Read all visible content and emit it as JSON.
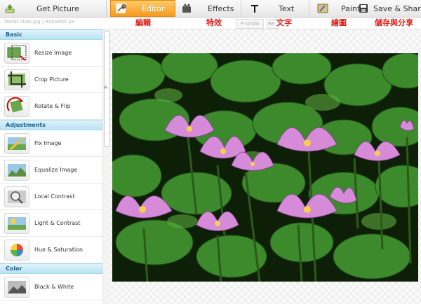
{
  "tabs": [
    {
      "label": "Get Picture",
      "icon": "upload-icon"
    },
    {
      "label": "Editor",
      "icon": "wrench-icon",
      "active": true
    },
    {
      "label": "Effects",
      "icon": "effects-icon"
    },
    {
      "label": "Text",
      "icon": "text-icon"
    },
    {
      "label": "Paint",
      "icon": "paint-icon"
    },
    {
      "label": "Save & Share",
      "icon": "save-icon"
    }
  ],
  "file_info": "Water lilies.jpg | 800x600 px",
  "chinese_labels": {
    "editor": "編輯",
    "effects": "特效",
    "text": "文字",
    "paint": "繪圖",
    "save_share": "儲存與分享"
  },
  "history": {
    "undo": "Undo",
    "redo": "Re"
  },
  "sections": [
    {
      "title": "Basic",
      "tools": [
        {
          "label": "Resize Image",
          "icon": "resize-icon"
        },
        {
          "label": "Crop Picture",
          "icon": "crop-icon"
        },
        {
          "label": "Rotate & Flip",
          "icon": "rotate-icon"
        }
      ]
    },
    {
      "title": "Adjustments",
      "tools": [
        {
          "label": "Fix Image",
          "icon": "fix-image-icon"
        },
        {
          "label": "Equalize Image",
          "icon": "equalize-icon"
        },
        {
          "label": "Local Contrast",
          "icon": "local-contrast-icon"
        },
        {
          "label": "Light & Contrast",
          "icon": "light-contrast-icon"
        },
        {
          "label": "Hue & Saturation",
          "icon": "hue-saturation-icon"
        }
      ]
    },
    {
      "title": "Color",
      "tools": [
        {
          "label": "Black & White",
          "icon": "black-white-icon"
        }
      ]
    }
  ],
  "colors": {
    "accent": "#f59a1f",
    "label_red": "#e0201b",
    "section_text": "#1a5f8c"
  }
}
